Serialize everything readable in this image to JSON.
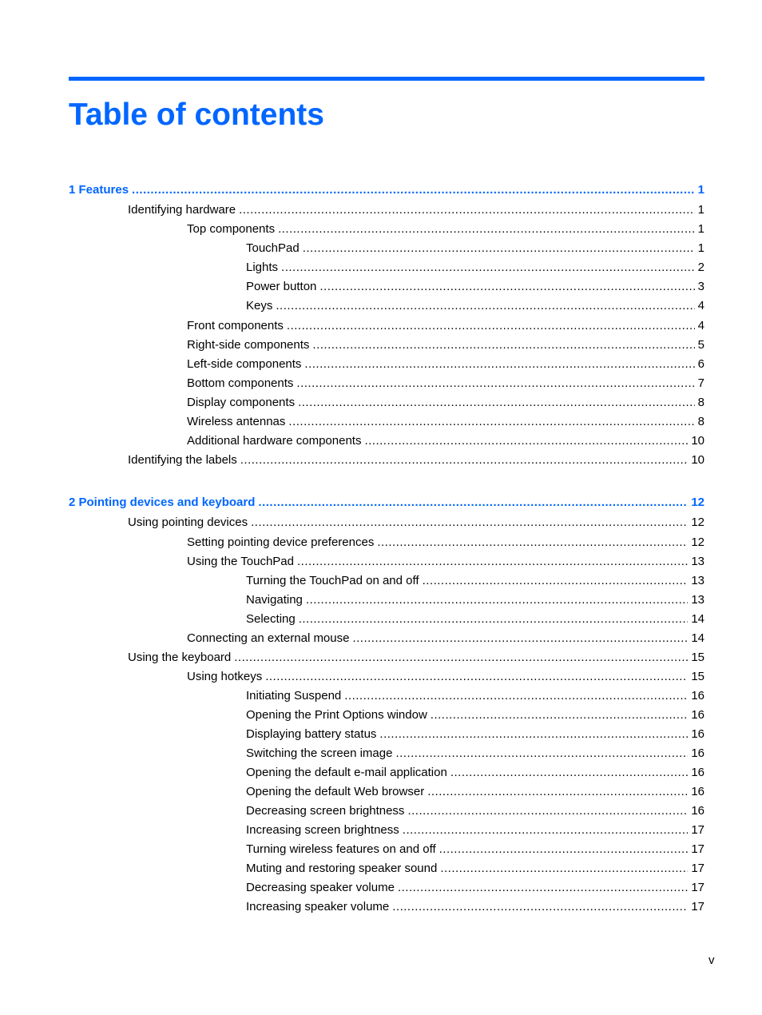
{
  "header": {
    "title": "Table of contents"
  },
  "toc": [
    {
      "level": 0,
      "label": "1  Features",
      "page": "1",
      "chapter": true
    },
    {
      "level": 1,
      "label": "Identifying hardware",
      "page": "1"
    },
    {
      "level": 2,
      "label": "Top components",
      "page": "1"
    },
    {
      "level": 3,
      "label": "TouchPad",
      "page": "1"
    },
    {
      "level": 3,
      "label": "Lights",
      "page": "2"
    },
    {
      "level": 3,
      "label": "Power button",
      "page": "3"
    },
    {
      "level": 3,
      "label": "Keys",
      "page": "4"
    },
    {
      "level": 2,
      "label": "Front components",
      "page": "4"
    },
    {
      "level": 2,
      "label": "Right-side components",
      "page": "5"
    },
    {
      "level": 2,
      "label": "Left-side components",
      "page": "6"
    },
    {
      "level": 2,
      "label": "Bottom components",
      "page": "7"
    },
    {
      "level": 2,
      "label": "Display components",
      "page": "8"
    },
    {
      "level": 2,
      "label": "Wireless antennas",
      "page": "8"
    },
    {
      "level": 2,
      "label": "Additional hardware components",
      "page": "10"
    },
    {
      "level": 1,
      "label": "Identifying the labels",
      "page": "10"
    },
    {
      "level": 0,
      "label": "2  Pointing devices and keyboard",
      "page": "12",
      "chapter": true
    },
    {
      "level": 1,
      "label": "Using pointing devices",
      "page": "12"
    },
    {
      "level": 2,
      "label": "Setting pointing device preferences",
      "page": "12"
    },
    {
      "level": 2,
      "label": "Using the TouchPad",
      "page": "13"
    },
    {
      "level": 3,
      "label": "Turning the TouchPad on and off",
      "page": "13"
    },
    {
      "level": 3,
      "label": "Navigating",
      "page": "13"
    },
    {
      "level": 3,
      "label": "Selecting",
      "page": "14"
    },
    {
      "level": 2,
      "label": "Connecting an external mouse",
      "page": "14"
    },
    {
      "level": 1,
      "label": "Using the keyboard",
      "page": "15"
    },
    {
      "level": 2,
      "label": "Using hotkeys",
      "page": "15"
    },
    {
      "level": 3,
      "label": "Initiating Suspend",
      "page": "16"
    },
    {
      "level": 3,
      "label": "Opening the Print Options window",
      "page": "16"
    },
    {
      "level": 3,
      "label": "Displaying battery status",
      "page": "16"
    },
    {
      "level": 3,
      "label": "Switching the screen image",
      "page": "16"
    },
    {
      "level": 3,
      "label": "Opening the default e-mail application",
      "page": "16"
    },
    {
      "level": 3,
      "label": "Opening the default Web browser",
      "page": "16"
    },
    {
      "level": 3,
      "label": "Decreasing screen brightness",
      "page": "16"
    },
    {
      "level": 3,
      "label": "Increasing screen brightness",
      "page": "17"
    },
    {
      "level": 3,
      "label": "Turning wireless features on and off",
      "page": "17"
    },
    {
      "level": 3,
      "label": "Muting and restoring speaker sound",
      "page": "17"
    },
    {
      "level": 3,
      "label": "Decreasing speaker volume",
      "page": "17"
    },
    {
      "level": 3,
      "label": "Increasing speaker volume",
      "page": "17"
    }
  ],
  "footer": {
    "folio": "v"
  },
  "colors": {
    "accent": "#0066ff",
    "text": "#000000"
  }
}
